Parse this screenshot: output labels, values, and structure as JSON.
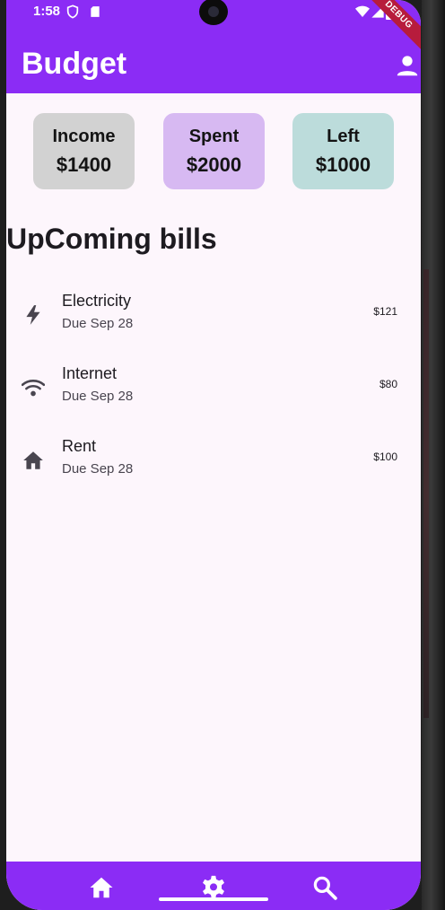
{
  "status_bar": {
    "time": "1:58",
    "icons": [
      "shield-icon",
      "sd-card-icon",
      "wifi-icon",
      "signal-icon",
      "battery-icon"
    ]
  },
  "debug_banner": "DEBUG",
  "app_bar": {
    "title": "Budget",
    "action_icon": "person-icon"
  },
  "summary": [
    {
      "label": "Income",
      "value": "$1400",
      "color": "#d2d2d2"
    },
    {
      "label": "Spent",
      "value": "$2000",
      "color": "#d7b9f2"
    },
    {
      "label": "Left",
      "value": "$1000",
      "color": "#bcdcdb"
    }
  ],
  "bills_section": {
    "title": "UpComing bills",
    "items": [
      {
        "icon": "bolt-icon",
        "name": "Electricity",
        "due": "Due Sep 28",
        "amount": "$121"
      },
      {
        "icon": "wifi-icon",
        "name": "Internet",
        "due": "Due Sep 28",
        "amount": "$80"
      },
      {
        "icon": "home-icon",
        "name": "Rent",
        "due": "Due Sep 28",
        "amount": "$100"
      }
    ]
  },
  "bottom_nav": {
    "items": [
      "home-icon",
      "settings-icon",
      "search-icon"
    ]
  },
  "colors": {
    "primary": "#8b2cf5",
    "background": "#fdf6fc",
    "text": "#1d1b20",
    "icon": "#49454f"
  }
}
